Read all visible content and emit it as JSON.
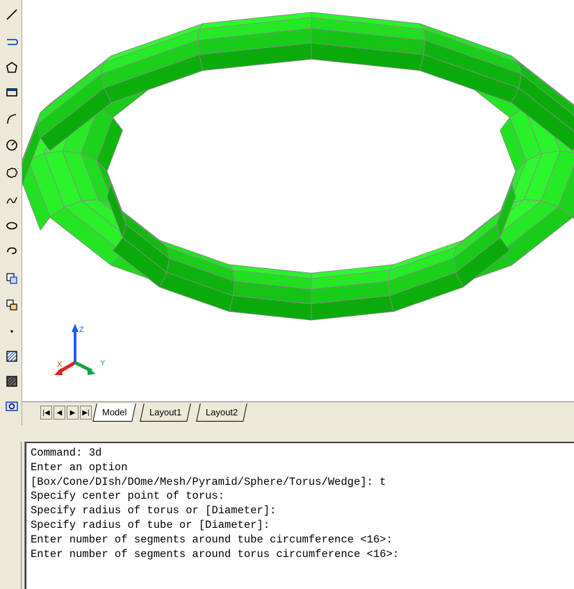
{
  "toolbar": {
    "tools": [
      {
        "name": "line-icon"
      },
      {
        "name": "polyline-icon"
      },
      {
        "name": "polygon-icon"
      },
      {
        "name": "rectangle-icon"
      },
      {
        "name": "arc-icon"
      },
      {
        "name": "circle-icon"
      },
      {
        "name": "revision-cloud-icon"
      },
      {
        "name": "spline-icon"
      },
      {
        "name": "ellipse-icon"
      },
      {
        "name": "ellipse-arc-icon"
      },
      {
        "name": "insert-block-icon"
      },
      {
        "name": "make-block-icon"
      },
      {
        "name": "point-icon"
      },
      {
        "name": "hatch-icon"
      },
      {
        "name": "gradient-icon"
      },
      {
        "name": "region-icon"
      }
    ]
  },
  "viewport": {
    "object": "torus",
    "object_color": "#22dd22",
    "wire_color": "#8a8a8a",
    "ucs": {
      "x_label": "X",
      "y_label": "Y",
      "z_label": "Z"
    }
  },
  "tabs": {
    "nav": [
      "first-tab-button",
      "prev-tab-button",
      "next-tab-button",
      "last-tab-button"
    ],
    "items": [
      {
        "label": "Model",
        "active": true
      },
      {
        "label": "Layout1",
        "active": false
      },
      {
        "label": "Layout2",
        "active": false
      }
    ]
  },
  "command_window": {
    "lines": [
      "Command: 3d",
      "Enter an option",
      "[Box/Cone/DIsh/DOme/Mesh/Pyramid/Sphere/Torus/Wedge]: t",
      "Specify center point of torus:",
      "Specify radius of torus or [Diameter]:",
      "Specify radius of tube or [Diameter]:",
      "Enter number of segments around tube circumference <16>:",
      "Enter number of segments around torus circumference <16>:"
    ]
  }
}
